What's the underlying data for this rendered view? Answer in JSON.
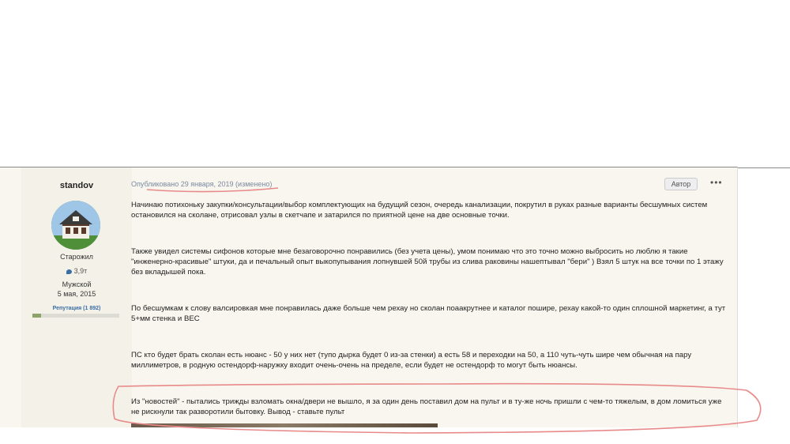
{
  "author": {
    "username": "standov",
    "rank": "Старожил",
    "posts_count": "3,9т",
    "gender": "Мужской",
    "joined": "5 мая, 2015",
    "reputation_label": "Репутация (1 892)",
    "reputation_fraction": 0.1
  },
  "post": {
    "published": "Опубликовано 29 января, 2019 (изменено)",
    "author_badge": "Автор",
    "menu": "•••",
    "paragraphs": [
      "Начинаю потихоньку закупки/консультации/выбор комплектующих на будущий сезон, очередь канализации, покрутил в руках разные варианты бесшумных систем остановился на сколане, отрисовал узлы в скетчапе и затарился по приятной цене на две основные точки.",
      "Также увидел системы сифонов которые мне безаговорочно понравились (без учета цены), умом понимаю что это точно можно выбросить но люблю я такие \"инженерно-красивые\" штуки, да и печальный опыт выкопупывания лопнувшей 50й трубы из слива раковины нашептывал \"бери\" ) Взял 5 штук на все точки по 1 этажу без вкладышей пока.",
      "По бесшумкам к слову валсировкая мне понравилась даже больше чем рехау но сколан поаакрутнее и каталог пошире, рехау какой-то один сплошной маркетинг, а тут 5+мм стенка и ВЕС",
      "ПС кто будет брать сколан есть нюанс - 50 у них нет (тупо дырка будет 0 из-за стенки) а есть 58 и переходки на 50, а 110 чуть-чуть шире чем обычная на пару миллиметров, в родную остендорф-наружку входит очень-очень на пределе, если будет не остендорф то могут быть нюансы.",
      "Из \"новостей\" - пытались трижды взломать окна/двери не вышло, я за один день поставил дом на пульт и в ту-же ночь пришли с чем-то тяжелым, в дом ломиться уже не рискнули так разворотили бытовку. Вывод - ставьте пульт"
    ]
  },
  "colors": {
    "annotation": "#e88a8a",
    "link": "#7a8aa0",
    "post_bg": "#f8f6ee"
  },
  "icons": [
    "comment-icon",
    "avatar-house-image",
    "more-options-icon"
  ]
}
